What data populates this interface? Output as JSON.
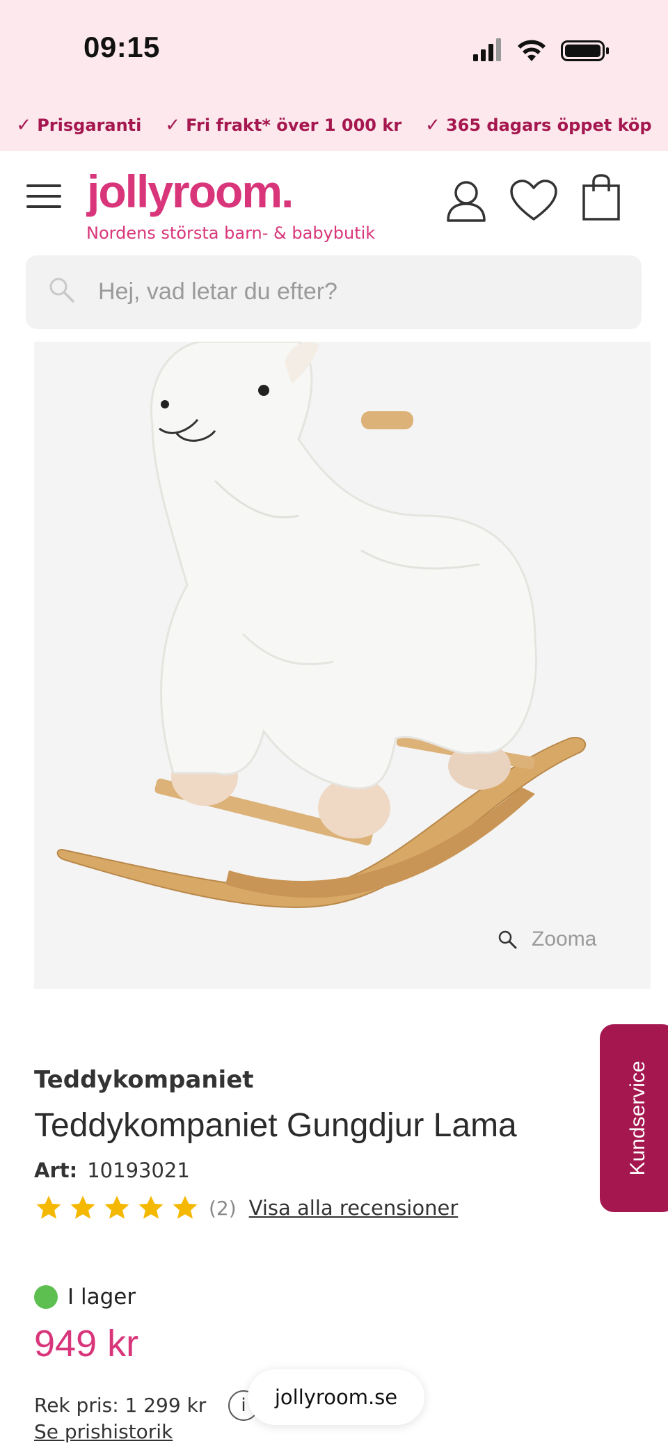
{
  "status_bar": {
    "time": "09:15"
  },
  "usps": [
    {
      "label": "Prisgaranti"
    },
    {
      "label": "Fri frakt* över 1 000 kr"
    },
    {
      "label": "365 dagars öppet köp"
    }
  ],
  "header": {
    "logo": "jollyroom.",
    "tagline": "Nordens största barn- & babybutik"
  },
  "search": {
    "placeholder": "Hej, vad letar du efter?"
  },
  "gallery": {
    "zoom_label": "Zooma"
  },
  "product": {
    "brand": "Teddykompaniet",
    "title": "Teddykompaniet Gungdjur Lama",
    "art_label": "Art:",
    "art_number": "10193021",
    "rating": 5,
    "review_count": "(2)",
    "review_link": "Visa alla recensioner",
    "stock_status": "I lager",
    "price": "949 kr",
    "rek_price": "Rek pris: 1 299 kr",
    "price_history_link": "Se prishistorik"
  },
  "kundservice": {
    "label": "Kundservice"
  },
  "browser": {
    "url": "jollyroom.se"
  },
  "colors": {
    "brand_pink": "#d8357a",
    "usp_text": "#a5174f",
    "topbar_bg": "#fce8ed",
    "star": "#f5b800",
    "stock_green": "#5cbf4f"
  }
}
